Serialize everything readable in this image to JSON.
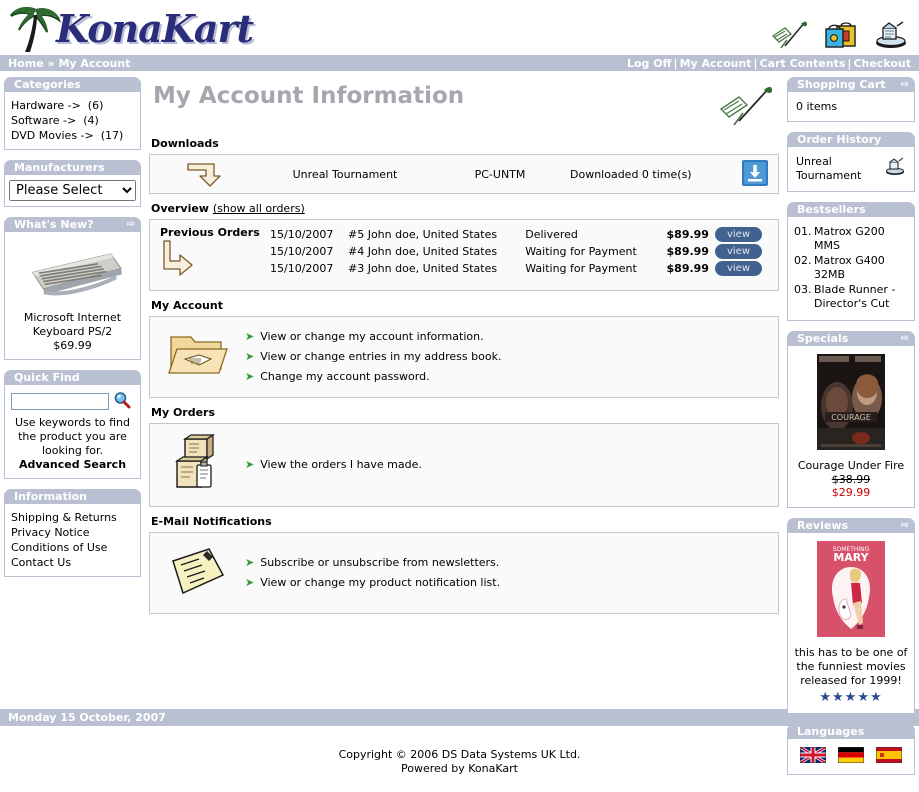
{
  "brand": {
    "name": "KonaKart",
    "logo_icon": "palm-tree-icon"
  },
  "header": {
    "icons": [
      {
        "name": "quill-writing-icon",
        "label": "My Account"
      },
      {
        "name": "shopping-bags-icon",
        "label": "Cart Contents"
      },
      {
        "name": "checkout-cart-icon",
        "label": "Checkout"
      }
    ]
  },
  "breadcrumb": {
    "home": "Home",
    "separator": "»",
    "current": "My Account"
  },
  "nav": {
    "items": [
      "Log Off",
      "My Account",
      "Cart Contents",
      "Checkout"
    ],
    "separator": "|"
  },
  "sidebar_left": {
    "categories": {
      "title": "Categories",
      "items": [
        {
          "label": "Hardware ->",
          "count": "(6)"
        },
        {
          "label": "Software ->",
          "count": "(4)"
        },
        {
          "label": "DVD Movies ->",
          "count": "(17)"
        }
      ]
    },
    "manufacturers": {
      "title": "Manufacturers",
      "selected": "Please Select",
      "options": [
        "Please Select"
      ]
    },
    "whats_new": {
      "title": "What's New?",
      "arrow": "⇨",
      "product_image": "keyboard-photo",
      "product_name": "Microsoft Internet Keyboard PS/2",
      "product_price": "$69.99"
    },
    "quick_find": {
      "title": "Quick Find",
      "input_value": "",
      "placeholder": "",
      "search_icon": "magnifier-icon",
      "help_text": "Use keywords to find the product you are looking for.",
      "advanced_link": "Advanced Search"
    },
    "information": {
      "title": "Information",
      "items": [
        "Shipping & Returns",
        "Privacy Notice",
        "Conditions of Use",
        "Contact Us"
      ]
    }
  },
  "main": {
    "title": "My Account Information",
    "title_decoration_icon": "quill-writing-icon",
    "downloads": {
      "label": "Downloads",
      "rows": [
        {
          "icon": "arrow-hook-icon",
          "name": "Unreal Tournament",
          "sku": "PC-UNTM",
          "count_text": "Downloaded 0 time(s)",
          "button_icon": "download-icon"
        }
      ]
    },
    "overview": {
      "label": "Overview",
      "show_all_link": "(show all orders)",
      "group_title": "Previous Orders",
      "group_icon": "curved-arrow-icon",
      "orders": [
        {
          "date": "15/10/2007",
          "who": "#5 John doe, United States",
          "status": "Delivered",
          "amount": "$89.99",
          "button": "view"
        },
        {
          "date": "15/10/2007",
          "who": "#4 John doe, United States",
          "status": "Waiting for Payment",
          "amount": "$89.99",
          "button": "view"
        },
        {
          "date": "15/10/2007",
          "who": "#3 John doe, United States",
          "status": "Waiting for Payment",
          "amount": "$89.99",
          "button": "view"
        }
      ]
    },
    "my_account": {
      "label": "My Account",
      "icon": "folder-address-book-icon",
      "links": [
        "View or change my account information.",
        "View or change entries in my address book.",
        "Change my account password."
      ]
    },
    "my_orders": {
      "label": "My Orders",
      "icon": "boxes-package-icon",
      "links": [
        "View the orders I have made."
      ]
    },
    "email_notifications": {
      "label": "E-Mail Notifications",
      "icon": "note-pencil-icon",
      "links": [
        "Subscribe or unsubscribe from newsletters.",
        "View or change my product notification list."
      ]
    }
  },
  "sidebar_right": {
    "shopping_cart": {
      "title": "Shopping Cart",
      "arrow": "⇨",
      "content": "0 items"
    },
    "order_history": {
      "title": "Order History",
      "item": "Unreal Tournament",
      "icon": "cart-small-icon"
    },
    "bestsellers": {
      "title": "Bestsellers",
      "items": [
        {
          "num": "01.",
          "name": "Matrox G200 MMS"
        },
        {
          "num": "02.",
          "name": "Matrox G400 32MB"
        },
        {
          "num": "03.",
          "name": "Blade Runner - Director's Cut"
        }
      ]
    },
    "specials": {
      "title": "Specials",
      "arrow": "⇨",
      "image": "courage-under-fire-poster",
      "name": "Courage Under Fire",
      "old_price": "$38.99",
      "new_price": "$29.99"
    },
    "reviews": {
      "title": "Reviews",
      "arrow": "⇨",
      "image": "something-about-mary-poster",
      "text": "this has to be one of the funniest movies released for 1999!",
      "stars": "★★★★★"
    },
    "languages": {
      "title": "Languages",
      "items": [
        {
          "name": "flag-english-icon",
          "label": "English"
        },
        {
          "name": "flag-german-icon",
          "label": "German"
        },
        {
          "name": "flag-spanish-icon",
          "label": "Spanish"
        }
      ]
    }
  },
  "footer": {
    "date": "Monday 15 October, 2007",
    "copyright": "Copyright © 2006 DS Data Systems UK Ltd.",
    "powered": "Powered by KonaKart"
  },
  "colors": {
    "bar": "#b9c0d2",
    "title_gray": "#a6a6ae",
    "logo_blue": "#2b2d7a",
    "view_button": "#41628f",
    "sale_red": "#cc0000",
    "arrow_green": "#3a9a3a"
  }
}
